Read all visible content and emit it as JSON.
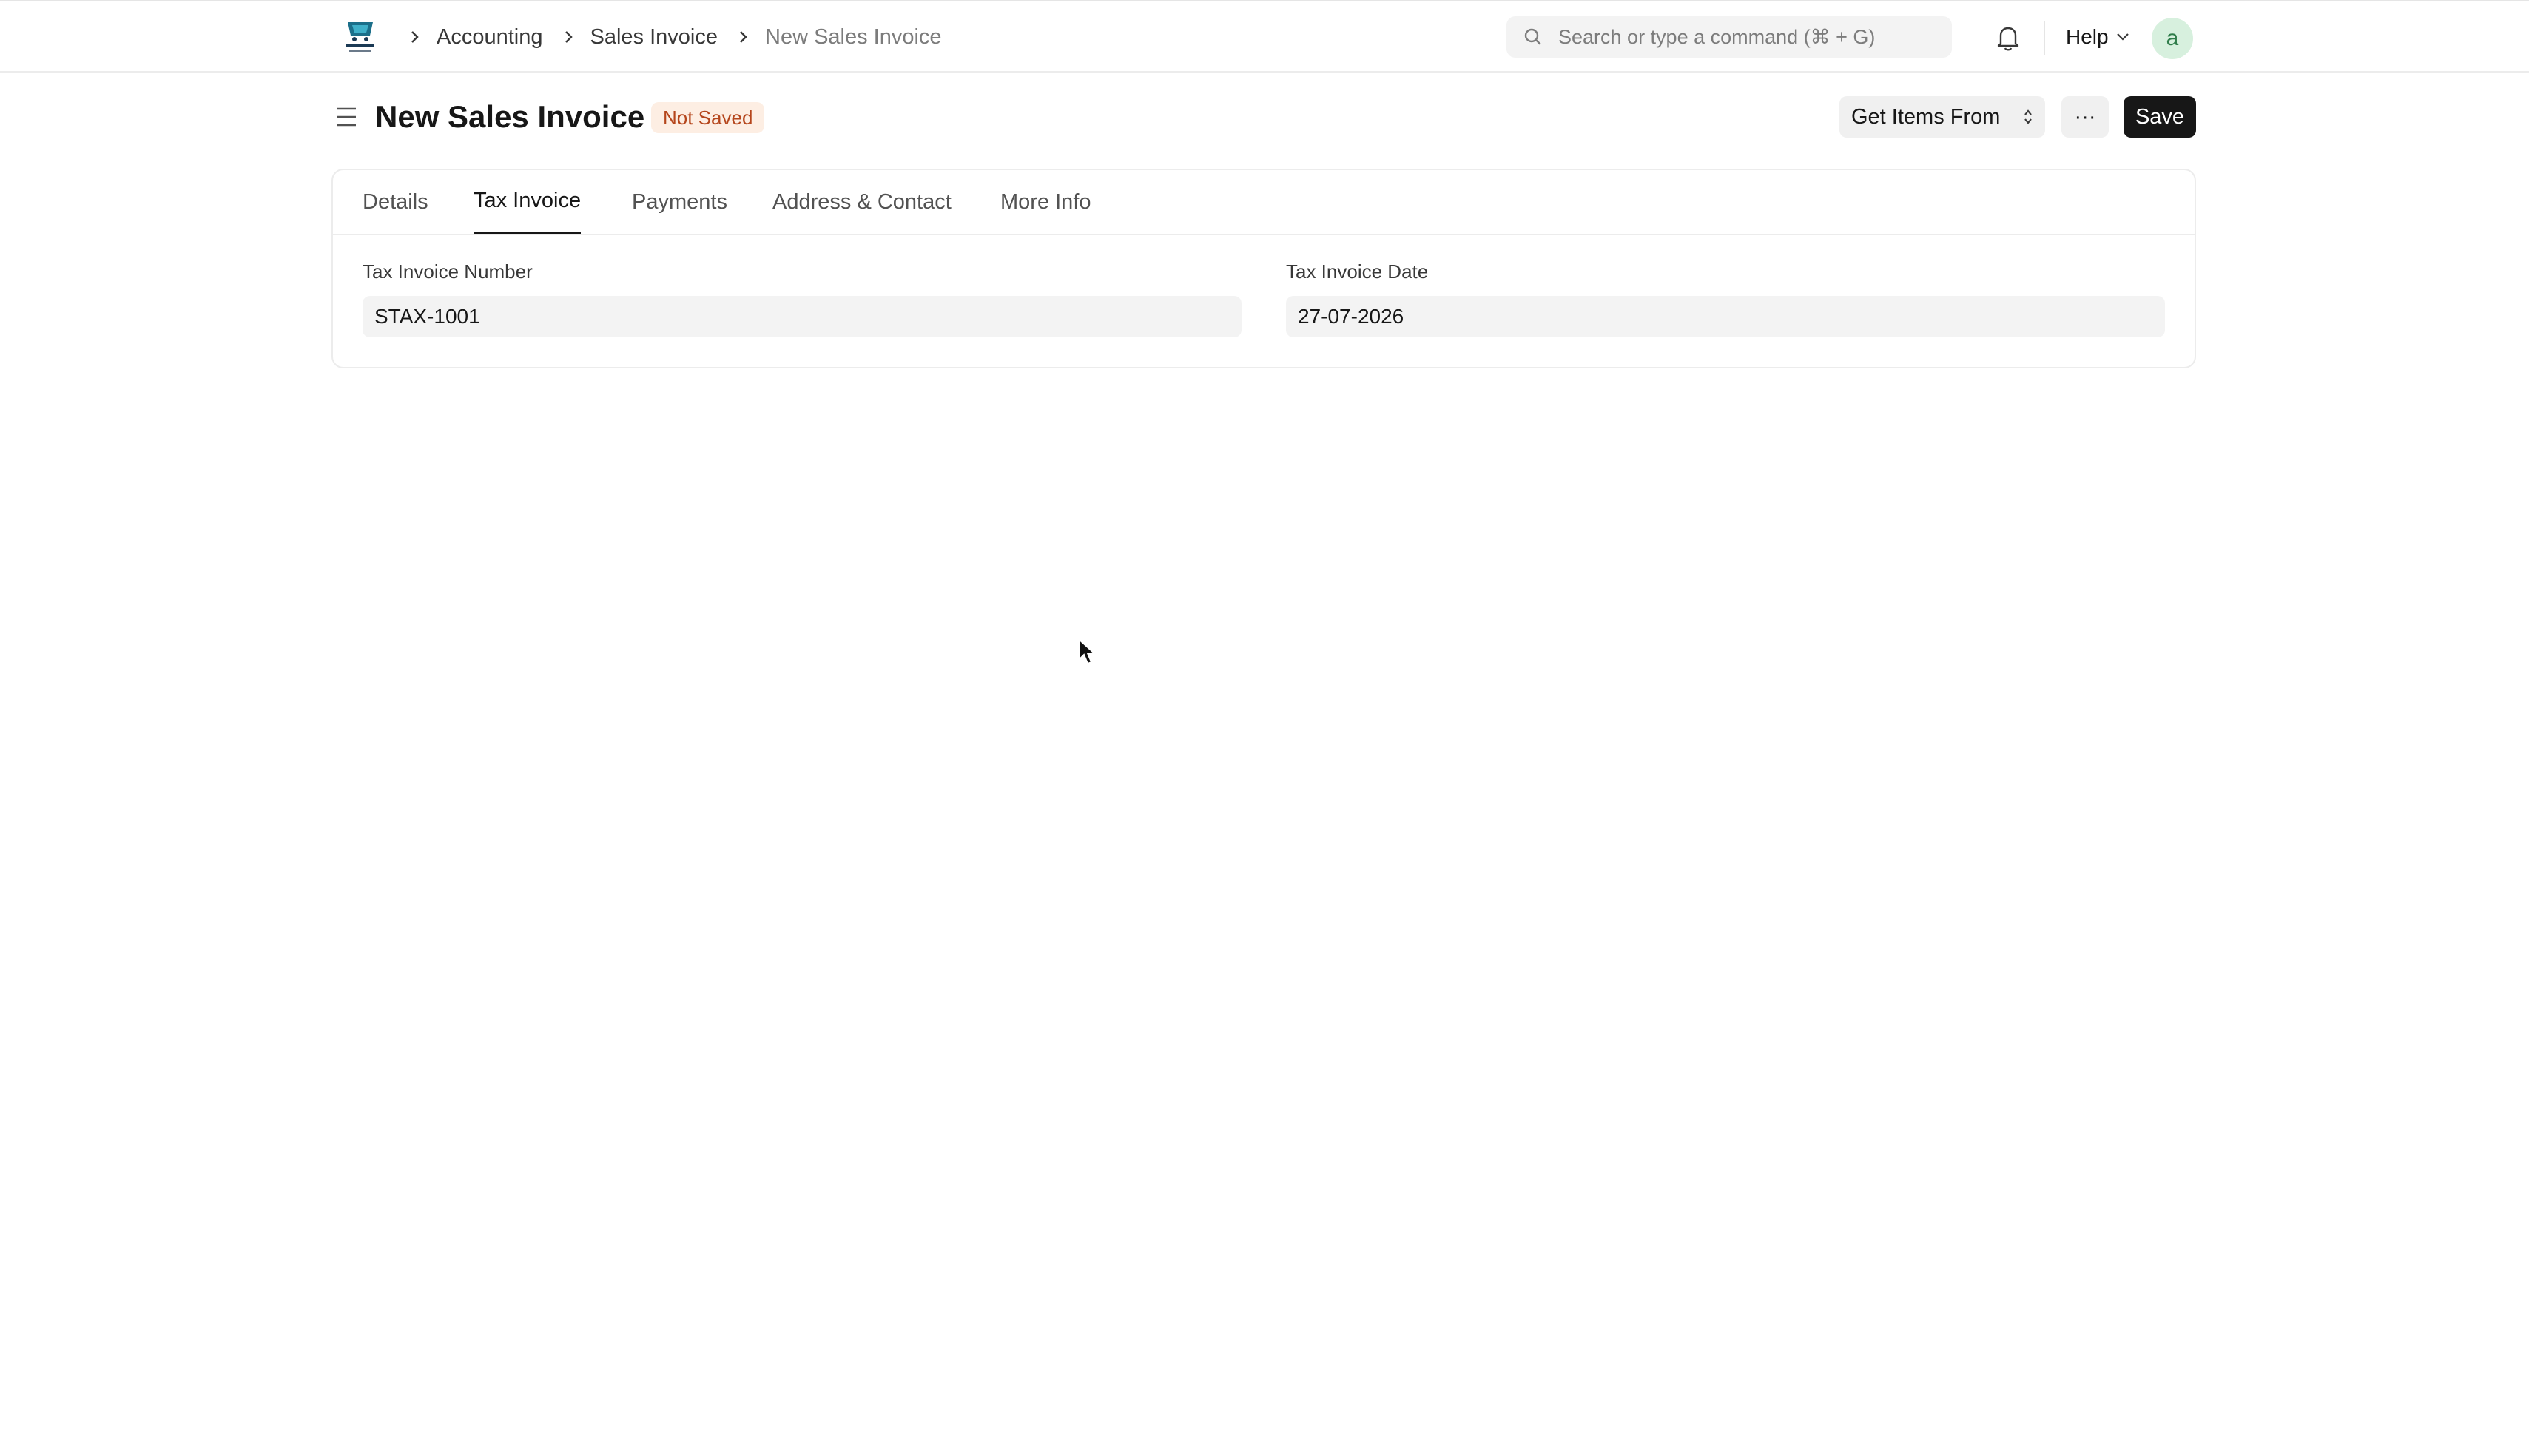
{
  "navbar": {
    "breadcrumbs": [
      {
        "label": "Accounting"
      },
      {
        "label": "Sales Invoice"
      },
      {
        "label": "New Sales Invoice"
      }
    ],
    "search_placeholder": "Search or type a command (⌘ + G)",
    "help_label": "Help",
    "avatar_initial": "a"
  },
  "page": {
    "title": "New Sales Invoice",
    "status": "Not Saved",
    "get_items_label": "Get Items From",
    "more_label": "···",
    "save_label": "Save"
  },
  "tabs": [
    {
      "label": "Details",
      "active": false
    },
    {
      "label": "Tax Invoice",
      "active": true
    },
    {
      "label": "Payments",
      "active": false
    },
    {
      "label": "Address & Contact",
      "active": false
    },
    {
      "label": "More Info",
      "active": false
    }
  ],
  "form": {
    "tax_invoice_number": {
      "label": "Tax Invoice Number",
      "value": "STAX-1001"
    },
    "tax_invoice_date": {
      "label": "Tax Invoice Date",
      "value": "27-07-2026"
    }
  },
  "colors": {
    "accent_dark": "#171717",
    "badge_bg": "#fdeee3",
    "badge_text": "#b5461c",
    "avatar_bg": "#d7f0de"
  }
}
